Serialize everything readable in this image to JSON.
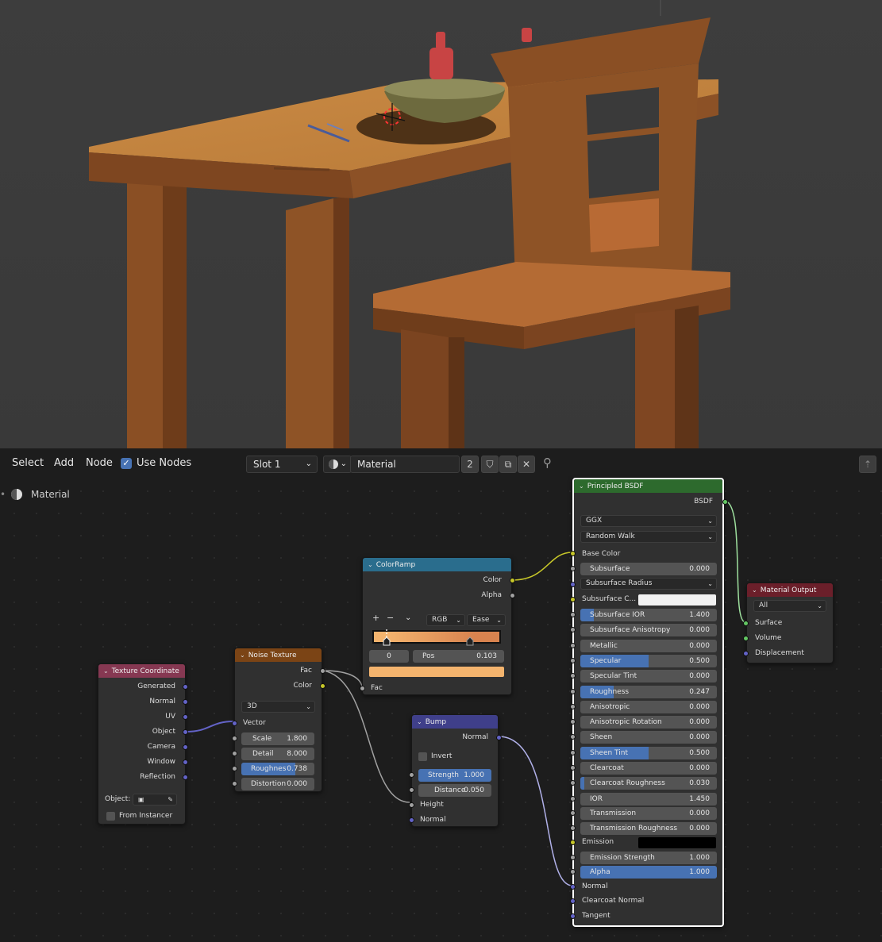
{
  "header": {
    "menu": [
      "Select",
      "Add",
      "Node"
    ],
    "use_nodes_label": "Use Nodes",
    "slot": "Slot 1",
    "material_name": "Material",
    "user_count": "2"
  },
  "breadcrumb": {
    "label": "Material"
  },
  "nodes": {
    "texcoord": {
      "title": "Texture Coordinate",
      "outputs": [
        "Generated",
        "Normal",
        "UV",
        "Object",
        "Camera",
        "Window",
        "Reflection"
      ],
      "object_label": "Object:",
      "from_instancer": "From Instancer"
    },
    "noise": {
      "title": "Noise Texture",
      "outputs": [
        "Fac",
        "Color"
      ],
      "dimensions": "3D",
      "vector_label": "Vector",
      "fields": [
        {
          "label": "Scale",
          "value": "1.800",
          "fill": 0
        },
        {
          "label": "Detail",
          "value": "8.000",
          "fill": 0
        },
        {
          "label": "Roughnes",
          "value": "0.738",
          "fill": 0.738
        },
        {
          "label": "Distortion",
          "value": "0.000",
          "fill": 0
        }
      ]
    },
    "ramp": {
      "title": "ColorRamp",
      "outputs": [
        "Color",
        "Alpha"
      ],
      "mode": "RGB",
      "interp": "Ease",
      "index": "0",
      "pos_label": "Pos",
      "pos_value": "0.103",
      "swatch": "#f4b46e",
      "input": "Fac",
      "ops": [
        "+",
        "−",
        "⌄"
      ]
    },
    "bump": {
      "title": "Bump",
      "output": "Normal",
      "invert": "Invert",
      "fields": [
        {
          "label": "Strength",
          "value": "1.000",
          "fill": 1
        },
        {
          "label": "Distance",
          "value": "0.050",
          "fill": 0
        }
      ],
      "inputs": [
        "Height",
        "Normal"
      ]
    },
    "bsdf": {
      "title": "Principled BSDF",
      "output": "BSDF",
      "distribution": "GGX",
      "subsurface_method": "Random Walk",
      "base_color": "Base Color",
      "subsurface_radius": "Subsurface Radius",
      "subsurface_color": "Subsurface C...",
      "emission": "Emission",
      "fields": [
        {
          "label": "Subsurface",
          "value": "0.000",
          "fill": 0
        },
        {
          "label": "Subsurface IOR",
          "value": "1.400",
          "fill": 0.1
        },
        {
          "label": "Subsurface Anisotropy",
          "value": "0.000",
          "fill": 0
        },
        {
          "label": "Metallic",
          "value": "0.000",
          "fill": 0
        },
        {
          "label": "Specular",
          "value": "0.500",
          "fill": 0.5
        },
        {
          "label": "Specular Tint",
          "value": "0.000",
          "fill": 0
        },
        {
          "label": "Roughness",
          "value": "0.247",
          "fill": 0.247
        },
        {
          "label": "Anisotropic",
          "value": "0.000",
          "fill": 0
        },
        {
          "label": "Anisotropic Rotation",
          "value": "0.000",
          "fill": 0
        },
        {
          "label": "Sheen",
          "value": "0.000",
          "fill": 0
        },
        {
          "label": "Sheen Tint",
          "value": "0.500",
          "fill": 0.5
        },
        {
          "label": "Clearcoat",
          "value": "0.000",
          "fill": 0
        },
        {
          "label": "Clearcoat Roughness",
          "value": "0.030",
          "fill": 0.03
        },
        {
          "label": "IOR",
          "value": "1.450",
          "fill": 0
        },
        {
          "label": "Transmission",
          "value": "0.000",
          "fill": 0
        },
        {
          "label": "Transmission Roughness",
          "value": "0.000",
          "fill": 0
        },
        {
          "label": "Emission Strength",
          "value": "1.000",
          "fill": 0
        },
        {
          "label": "Alpha",
          "value": "1.000",
          "fill": 1
        }
      ],
      "bottom_inputs": [
        "Normal",
        "Clearcoat Normal",
        "Tangent"
      ]
    },
    "output": {
      "title": "Material Output",
      "target": "All",
      "inputs": [
        "Surface",
        "Volume",
        "Displacement"
      ]
    }
  }
}
